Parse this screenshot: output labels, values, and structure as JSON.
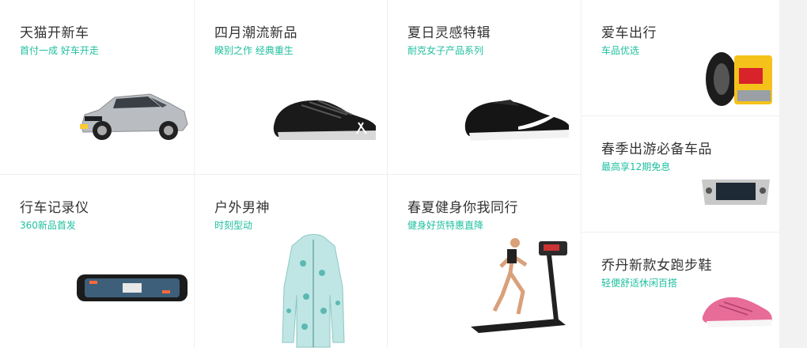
{
  "tiles": [
    {
      "title": "天猫开新车",
      "subtitle": "首付一成 好车开走",
      "image": "car-image"
    },
    {
      "title": "四月潮流新品",
      "subtitle": "睽别之作 经典重生",
      "image": "sneaker-image"
    },
    {
      "title": "夏日灵感特辑",
      "subtitle": "耐克女子产品系列",
      "image": "nike-shoe-image"
    },
    {
      "title": "行车记录仪",
      "subtitle": "360新品首发",
      "image": "dashcam-mirror-image"
    },
    {
      "title": "户外男神",
      "subtitle": "时刻型动",
      "image": "jacket-image"
    },
    {
      "title": "春夏健身你我同行",
      "subtitle": "健身好货特惠直降",
      "image": "treadmill-image"
    }
  ],
  "side_tiles": [
    {
      "title": "爱车出行",
      "subtitle": "车品优选",
      "image": "tire-oil-image"
    },
    {
      "title": "春季出游必备车品",
      "subtitle": "最高享12期免息",
      "image": "car-stereo-image"
    },
    {
      "title": "乔丹新款女跑步鞋",
      "subtitle": "轻便舒适休闲百搭",
      "image": "running-shoe-image"
    }
  ],
  "colors": {
    "accent": "#20c0a0",
    "title": "#333333",
    "divider": "#efefef"
  }
}
